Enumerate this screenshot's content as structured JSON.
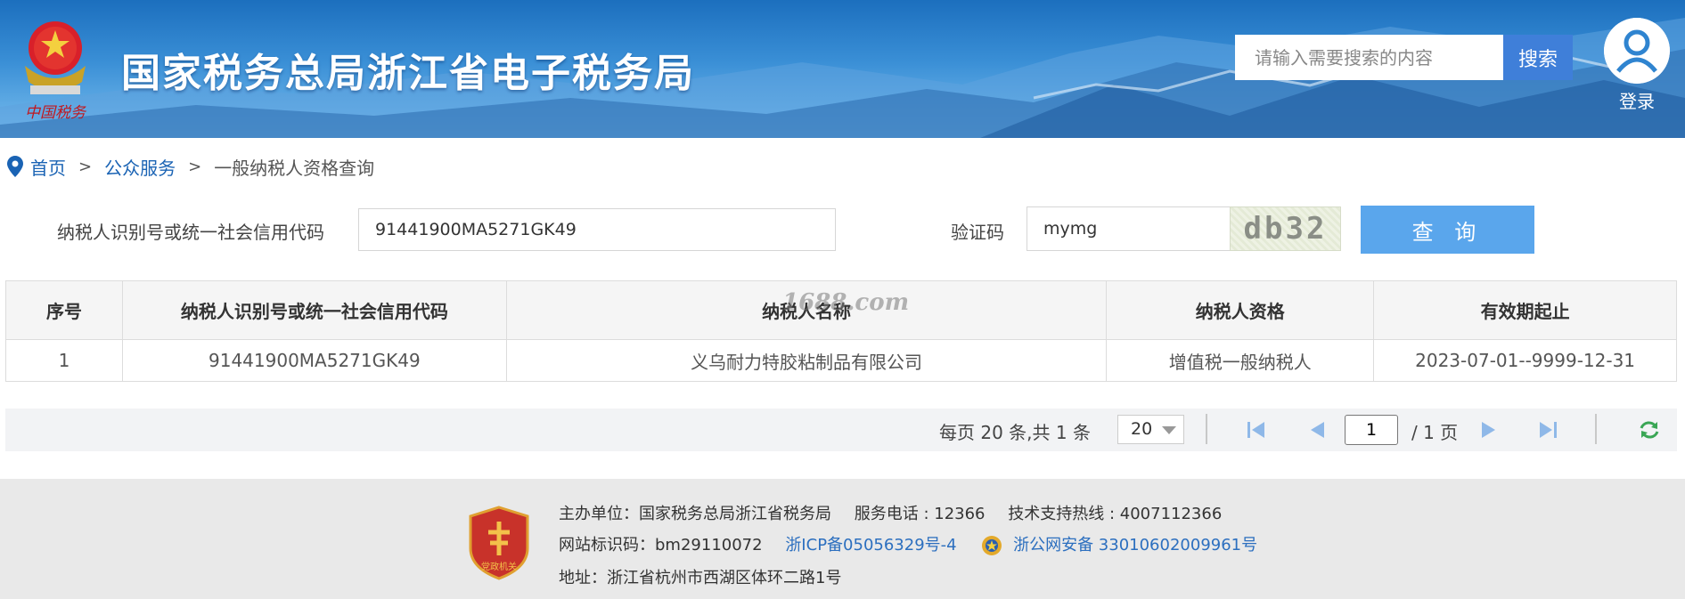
{
  "header": {
    "site_title": "国家税务总局浙江省电子税务局",
    "search_placeholder": "请输入需要搜索的内容",
    "search_button": "搜索",
    "login_label": "登录",
    "emblem_caption": "中国税务",
    "colors": {
      "banner": "#2f84d0",
      "search_button": "#3f7fd9"
    }
  },
  "breadcrumb": {
    "items": [
      {
        "label": "首页",
        "type": "link"
      },
      {
        "label": "公众服务",
        "type": "link"
      },
      {
        "label": "一般纳税人资格查询",
        "type": "current"
      }
    ],
    "separator": ">"
  },
  "query_form": {
    "taxpayer_id_label": "纳税人识别号或统一社会信用代码",
    "taxpayer_id_value": "91441900MA5271GK49",
    "captcha_label": "验证码",
    "captcha_value": "mymg",
    "captcha_image_text": "db32",
    "query_button": "查 询",
    "query_button_color": "#5aa6ec"
  },
  "results": {
    "columns": [
      "序号",
      "纳税人识别号或统一社会信用代码",
      "纳税人名称",
      "纳税人资格",
      "有效期起止"
    ],
    "rows": [
      [
        "1",
        "91441900MA5271GK49",
        "义乌耐力特胶粘制品有限公司",
        "增值税一般纳税人",
        "2023-07-01--9999-12-31"
      ]
    ]
  },
  "watermark": "1688.com",
  "pagination": {
    "summary": "每页 20 条,共 1 条",
    "page_size": "20",
    "current_page": "1",
    "total_pages": "/ 1 页"
  },
  "footer": {
    "sponsor": "主办单位：国家税务总局浙江省税务局",
    "service_phone": "服务电话 : 12366",
    "support_hotline": "技术支持热线 : 4007112366",
    "site_code": "网站标识码：bm29110072",
    "icp": "浙ICP备05056329号-4",
    "police_record": "浙公网安备 33010602009961号",
    "address": "地址：浙江省杭州市西湖区体环二路1号",
    "badge_text": "党政机关"
  }
}
